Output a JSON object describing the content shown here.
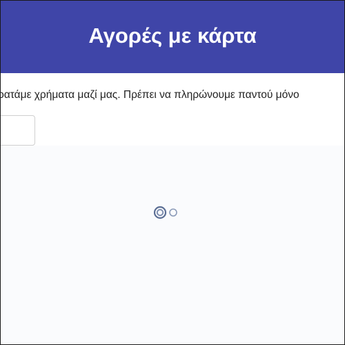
{
  "header": {
    "title": "Αγορές με κάρτα"
  },
  "main": {
    "instruction": "ρατάμε χρήματα μαζί μας. Πρέπει να πληρώνουμε παντού μόνο",
    "answer_input": {
      "value": "",
      "placeholder": ""
    }
  },
  "loading": {
    "icon": "loading-spinner-icon"
  },
  "colors": {
    "header_bg": "#3f45a8",
    "spinner": "#5b6e94"
  }
}
